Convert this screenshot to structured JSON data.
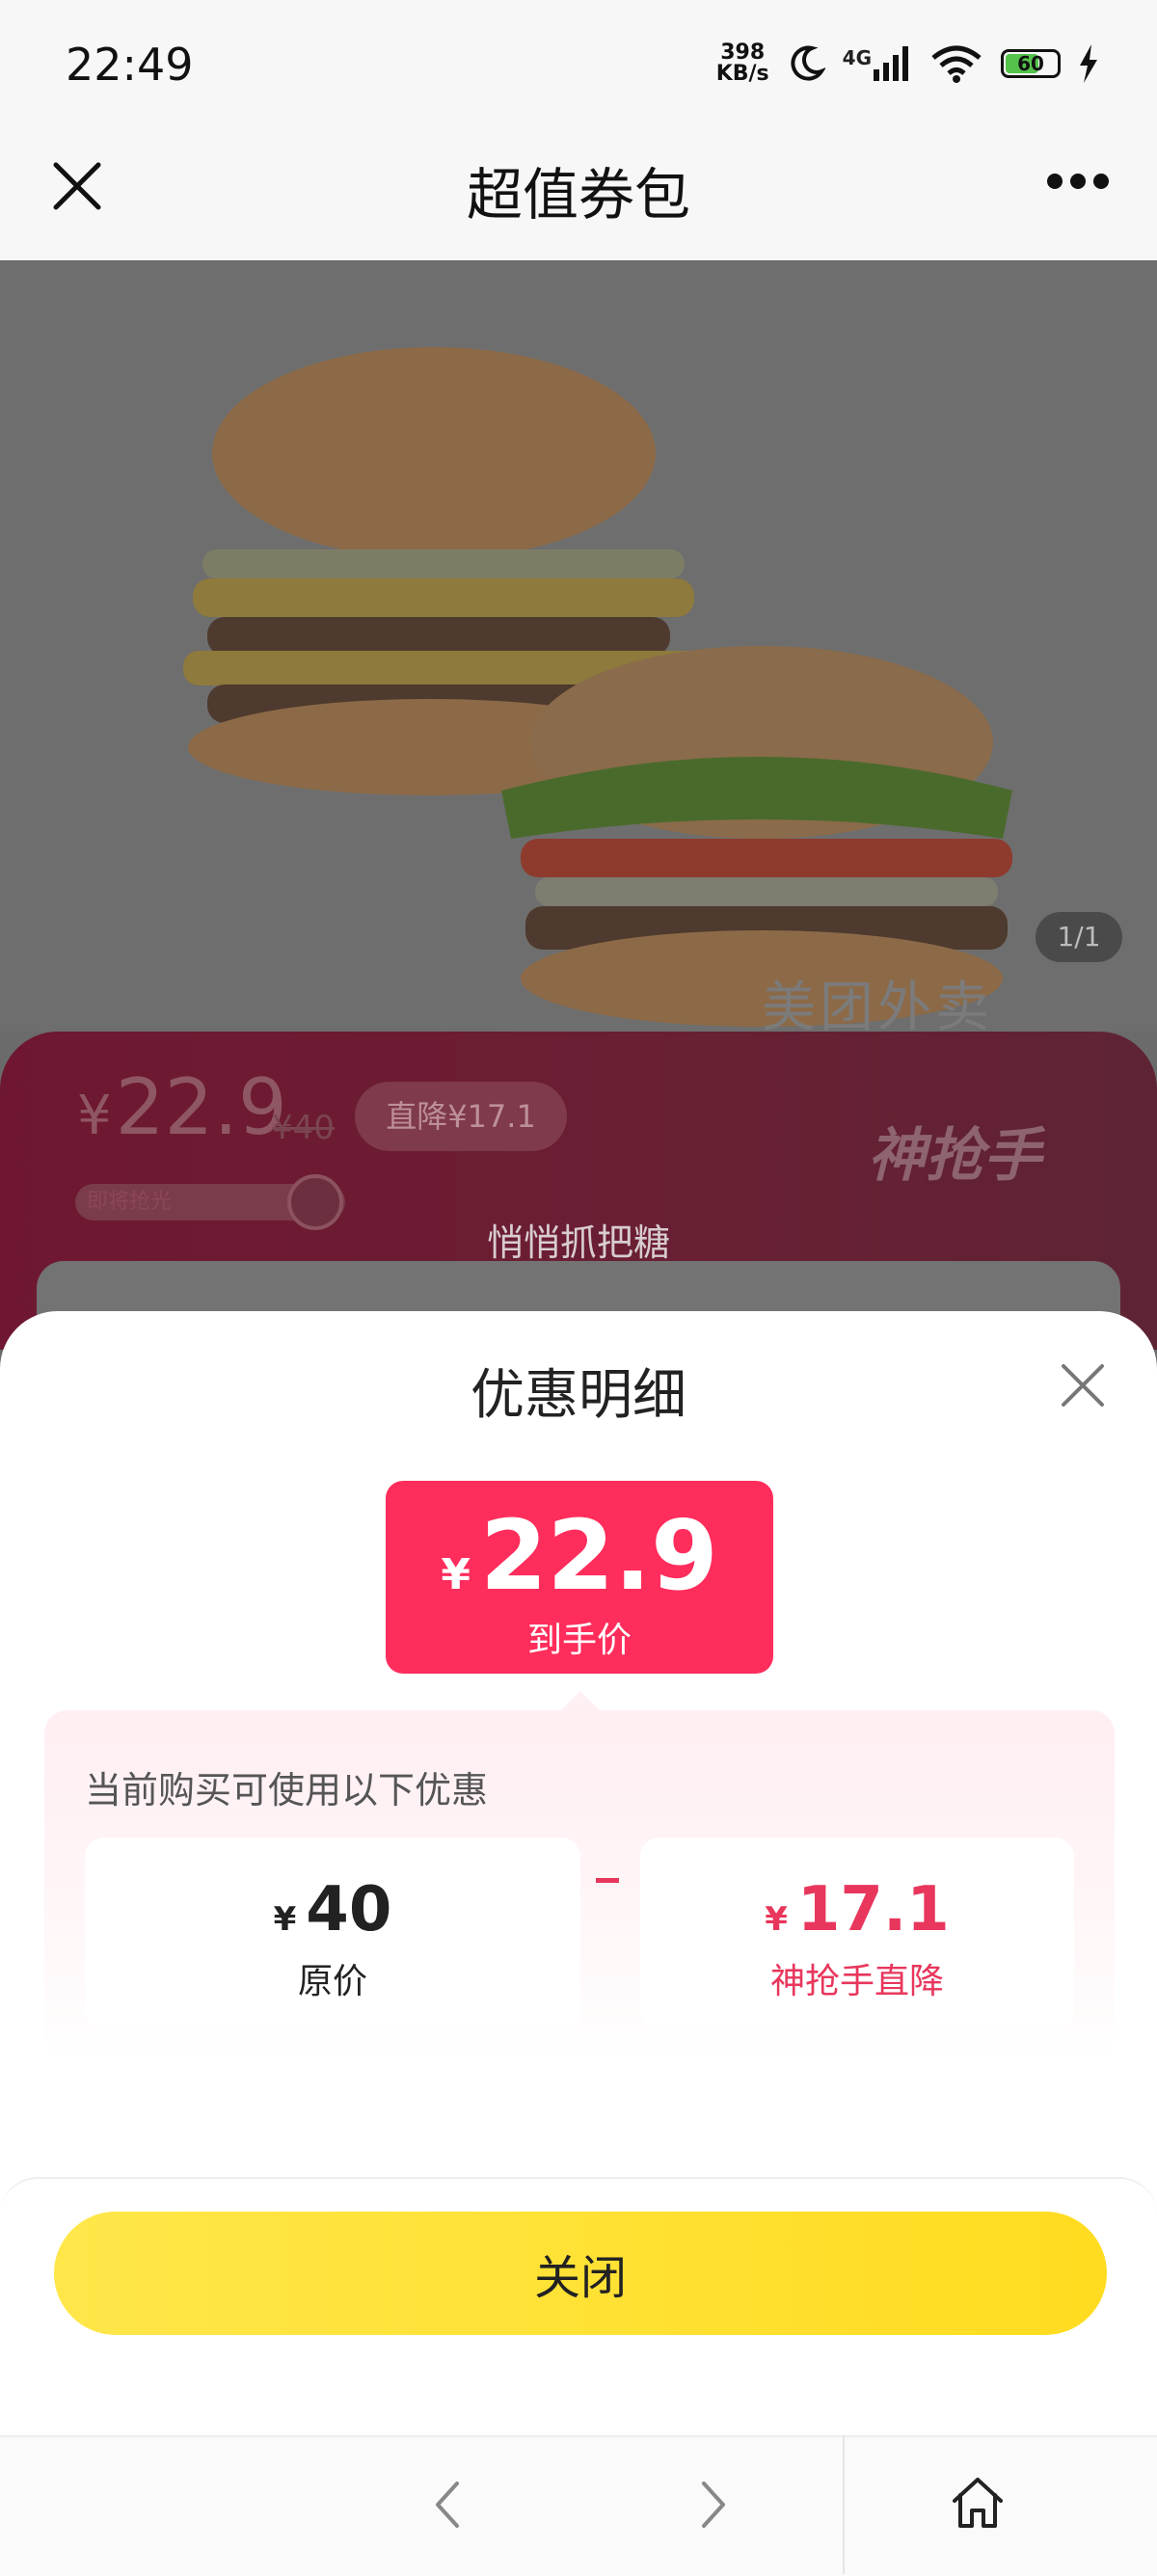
{
  "status_bar": {
    "time": "22:49",
    "net_speed_value": "398",
    "net_speed_unit": "KB/s",
    "network": "4G",
    "battery": "60",
    "icons": [
      "moon-icon",
      "signal-icon",
      "wifi-icon",
      "battery-icon",
      "charging-icon"
    ]
  },
  "header": {
    "title": "超值券包",
    "close_icon": "close-icon",
    "more_icon": "more-icon"
  },
  "hero": {
    "pager": "1/1",
    "watermark": "美团外卖"
  },
  "promo": {
    "price_currency": "¥",
    "price": "22.9",
    "original_price": "¥40",
    "discount_tag": "直降¥17.1",
    "stock_label": "即将抢光",
    "brand": "神抢手",
    "slogan": "悄悄抓把糖"
  },
  "sheet": {
    "title": "优惠明细",
    "final_currency": "¥",
    "final_price": "22.9",
    "final_label": "到手价",
    "intro": "当前购买可使用以下优惠",
    "original": {
      "currency": "¥",
      "amount": "40",
      "label": "原价"
    },
    "discount": {
      "currency": "¥",
      "amount": "17.1",
      "label": "神抢手直降"
    },
    "close_button": "关闭",
    "accent_color": "#ff2d5b",
    "button_color": "#ffde2a"
  },
  "nav": {
    "icons": [
      "back-icon",
      "forward-icon",
      "home-icon"
    ]
  }
}
